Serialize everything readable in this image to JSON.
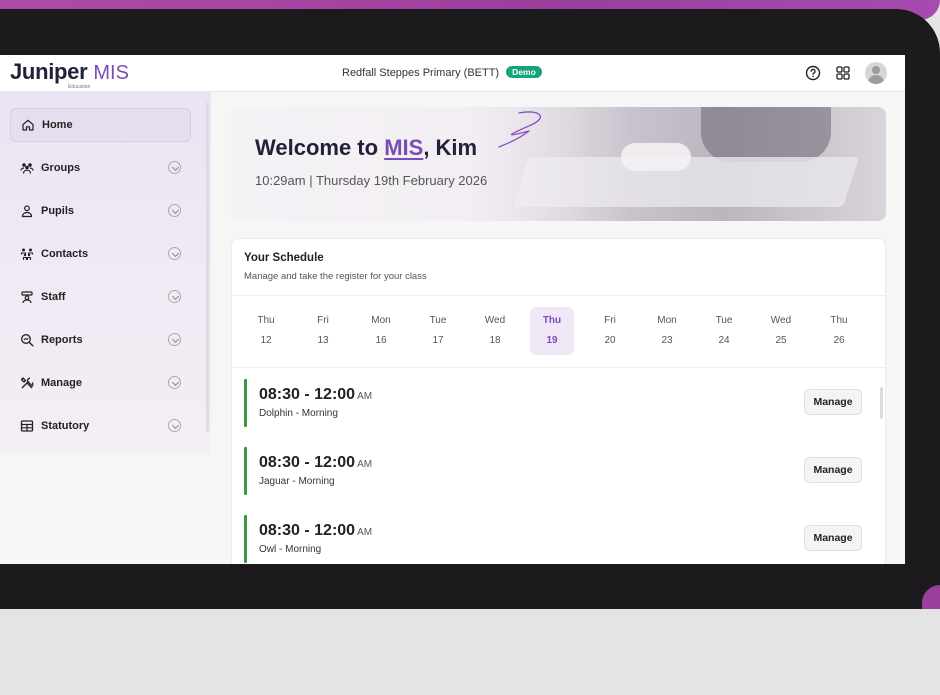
{
  "app": {
    "logo_text": "Juniper",
    "logo_product": "MIS",
    "logo_sub": "Education",
    "school_name": "Redfall Steppes Primary (BETT)",
    "demo_badge": "Demo",
    "accent_color": "#7b4bb8",
    "icons": [
      "help-icon",
      "apps-grid-icon",
      "user-avatar"
    ]
  },
  "sidebar": {
    "items": [
      {
        "label": "Home",
        "icon": "home-icon",
        "active": true
      },
      {
        "label": "Groups",
        "icon": "groups-icon"
      },
      {
        "label": "Pupils",
        "icon": "pupil-icon"
      },
      {
        "label": "Contacts",
        "icon": "contacts-icon"
      },
      {
        "label": "Staff",
        "icon": "staff-icon"
      },
      {
        "label": "Reports",
        "icon": "reports-icon"
      },
      {
        "label": "Manage",
        "icon": "tools-icon"
      },
      {
        "label": "Statutory",
        "icon": "table-icon"
      }
    ]
  },
  "banner": {
    "welcome_prefix": "Welcome to ",
    "welcome_highlight": "MIS",
    "welcome_suffix": ", Kim",
    "datetime": "10:29am | Thursday 19th February 2026"
  },
  "schedule": {
    "title": "Your Schedule",
    "subtitle": "Manage and take the register for your class",
    "days": [
      {
        "name": "Thu",
        "num": "12"
      },
      {
        "name": "Fri",
        "num": "13"
      },
      {
        "name": "Mon",
        "num": "16"
      },
      {
        "name": "Tue",
        "num": "17"
      },
      {
        "name": "Wed",
        "num": "18"
      },
      {
        "name": "Thu",
        "num": "19",
        "active": true
      },
      {
        "name": "Fri",
        "num": "20"
      },
      {
        "name": "Mon",
        "num": "23"
      },
      {
        "name": "Tue",
        "num": "24"
      },
      {
        "name": "Wed",
        "num": "25"
      },
      {
        "name": "Thu",
        "num": "26"
      }
    ],
    "slots": [
      {
        "time": "08:30 - 12:00",
        "ampm": "AM",
        "name": "Dolphin - Morning",
        "button": "Manage"
      },
      {
        "time": "08:30 - 12:00",
        "ampm": "AM",
        "name": "Jaguar - Morning",
        "button": "Manage"
      },
      {
        "time": "08:30 - 12:00",
        "ampm": "AM",
        "name": "Owl - Morning",
        "button": "Manage"
      }
    ],
    "slot_bar_color": "#3a9a3f"
  }
}
